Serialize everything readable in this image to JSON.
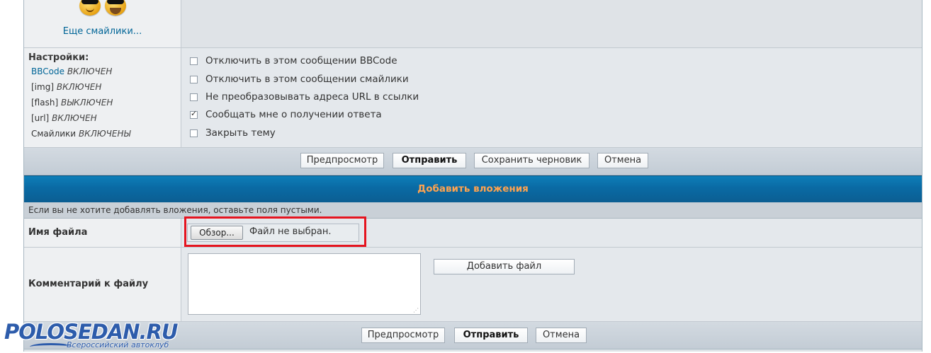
{
  "smilies": {
    "more_link": "Еще смайлики..."
  },
  "options": {
    "title": "Настройки:",
    "statuses": [
      {
        "name": "BBCode",
        "state": "ВКЛЮЧЕН"
      },
      {
        "name": "[img]",
        "state": "ВКЛЮЧЕН"
      },
      {
        "name": "[flash]",
        "state": "ВЫКЛЮЧЕН"
      },
      {
        "name": "[url]",
        "state": "ВКЛЮЧЕН"
      },
      {
        "name": "Смайлики",
        "state": "ВКЛЮЧЕНЫ"
      }
    ],
    "checkboxes": [
      {
        "label": "Отключить в этом сообщении BBCode",
        "checked": false
      },
      {
        "label": "Отключить в этом сообщении смайлики",
        "checked": false
      },
      {
        "label": "Не преобразовывать адреса URL в ссылки",
        "checked": false
      },
      {
        "label": "Сообщать мне о получении ответа",
        "checked": true
      },
      {
        "label": "Закрыть тему",
        "checked": false
      }
    ]
  },
  "top_buttons": {
    "preview": "Предпросмотр",
    "submit": "Отправить",
    "save_draft": "Сохранить черновик",
    "cancel": "Отмена"
  },
  "attachments": {
    "header": "Добавить вложения",
    "note": "Если вы не хотите добавлять вложения, оставьте поля пустыми.",
    "file_label": "Имя файла",
    "browse_button": "Обзор...",
    "file_status": "Файл не выбран.",
    "comment_label": "Комментарий к файлу",
    "comment_value": "",
    "add_file_button": "Добавить файл"
  },
  "bottom_buttons": {
    "preview": "Предпросмотр",
    "submit": "Отправить",
    "cancel": "Отмена"
  },
  "logo": {
    "main": "POLOSEDAN.RU",
    "sub": "Всероссийский автоклуб"
  },
  "colors": {
    "header_blue": "#0a6aa4",
    "header_text": "#ffa34f",
    "link": "#006597",
    "highlight_red": "#e5141f"
  }
}
